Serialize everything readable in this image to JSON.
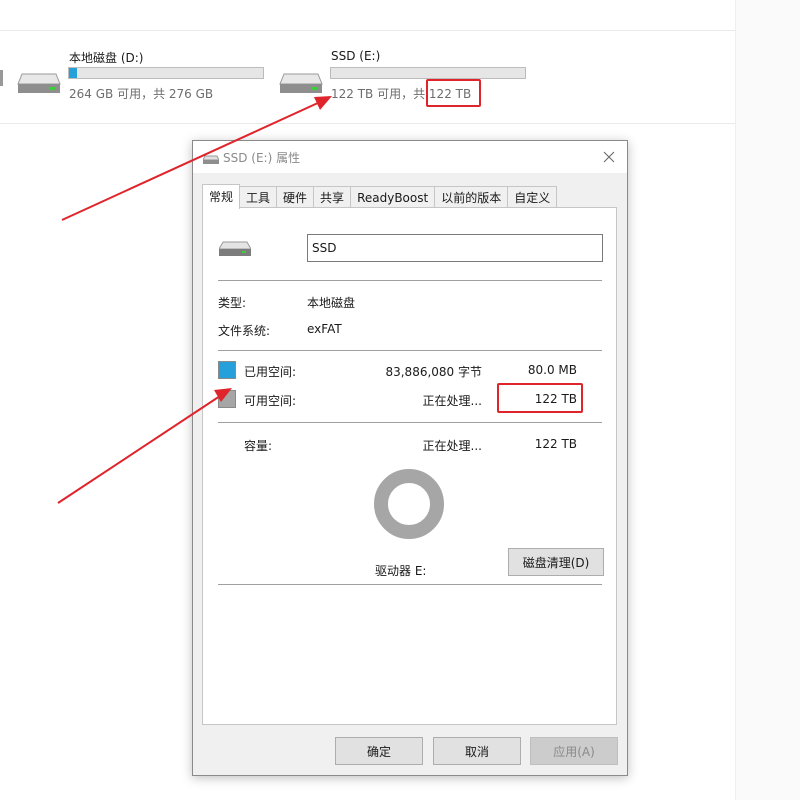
{
  "explorer": {
    "drive_d": {
      "name": "本地磁盘 (D:)",
      "free_text": "264 GB 可用，共 276 GB",
      "used_fraction": 0.04
    },
    "drive_e": {
      "name": "SSD (E:)",
      "free_text_prefix": "122 TB 可用，共",
      "free_text_total": " 122 TB",
      "used_fraction": 0.0
    }
  },
  "dialog": {
    "title": "SSD (E:) 属性",
    "tabs": [
      "常规",
      "工具",
      "硬件",
      "共享",
      "ReadyBoost",
      "以前的版本",
      "自定义"
    ],
    "active_tab": "常规",
    "drive_label_value": "SSD",
    "type_label": "类型:",
    "type_value": "本地磁盘",
    "fs_label": "文件系统:",
    "fs_value": "exFAT",
    "used": {
      "label": "已用空间:",
      "bytes": "83,886,080 字节",
      "size": "80.0 MB",
      "color": "#26a0da"
    },
    "free": {
      "label": "可用空间:",
      "bytes": "正在处理...",
      "size": "122 TB",
      "color": "#a6a6a6"
    },
    "capacity": {
      "label": "容量:",
      "bytes": "正在处理...",
      "size": "122 TB"
    },
    "drive_caption": "驱动器 E:",
    "cleanup_button": "磁盘清理(D)",
    "buttons": {
      "ok": "确定",
      "cancel": "取消",
      "apply": "应用(A)"
    }
  },
  "colors": {
    "highlight": "#e0242b",
    "used_blue": "#26a0da",
    "free_gray": "#a6a6a6"
  }
}
